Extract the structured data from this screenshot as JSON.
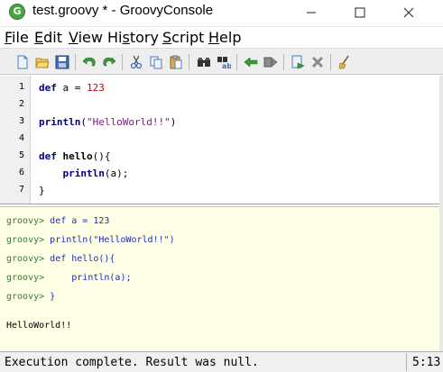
{
  "window": {
    "title": "test.groovy * - GroovyConsole",
    "app_icon": "groovy-logo-icon",
    "app_icon_letter": "G",
    "controls": [
      "minimize-icon",
      "maximize-icon",
      "close-icon"
    ]
  },
  "menu": {
    "items": [
      {
        "label": "File",
        "mnemonic": "F"
      },
      {
        "label": "Edit",
        "mnemonic": "E"
      },
      {
        "label": "View",
        "mnemonic": "V"
      },
      {
        "label": "History",
        "mnemonic": "s"
      },
      {
        "label": "Script",
        "mnemonic": "S"
      },
      {
        "label": "Help",
        "mnemonic": "H"
      }
    ]
  },
  "toolbar": {
    "buttons": [
      "new-file-icon",
      "open-folder-icon",
      "save-icon",
      "undo-icon",
      "redo-icon",
      "cut-icon",
      "copy-icon",
      "paste-icon",
      "find-icon",
      "replace-icon",
      "previous-history-icon",
      "next-history-icon",
      "run-script-icon",
      "interrupt-icon",
      "clear-output-icon"
    ]
  },
  "editor": {
    "lines": [
      {
        "no": "1",
        "text": "def a = 123"
      },
      {
        "no": "2",
        "text": ""
      },
      {
        "no": "3",
        "text": "println(\"HelloWorld!!\")"
      },
      {
        "no": "4",
        "text": ""
      },
      {
        "no": "5",
        "text": "def hello(){"
      },
      {
        "no": "6",
        "text": "    println(a);"
      },
      {
        "no": "7",
        "text": "}"
      }
    ]
  },
  "output": {
    "prompt": "groovy>",
    "lines": [
      " def a = 123",
      " println(\"HelloWorld!!\")",
      " def hello(){",
      "     println(a);",
      " }"
    ],
    "result": "HelloWorld!!"
  },
  "status": {
    "message": "Execution complete. Result was null.",
    "position": "5:13"
  },
  "colors": {
    "output_background": "#ffffe6",
    "prompt": "#2e7d2e",
    "keyword": "#000080",
    "number": "#c00000",
    "string": "#7a1a7a"
  }
}
